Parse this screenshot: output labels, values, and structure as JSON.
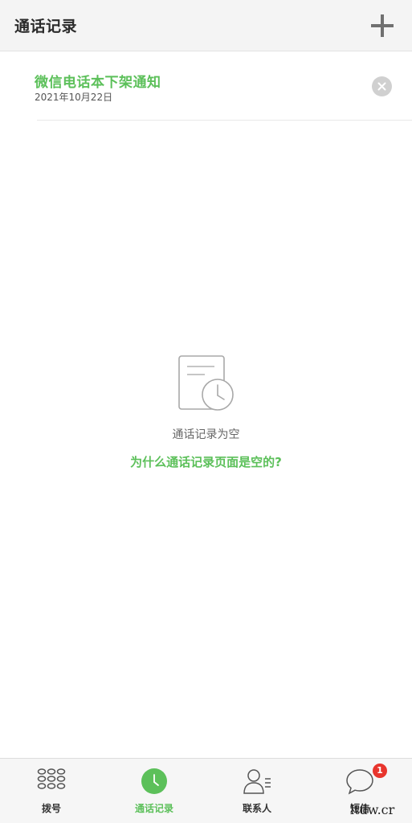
{
  "header": {
    "title": "通话记录"
  },
  "notice": {
    "title": "微信电话本下架通知",
    "date": "2021年10月22日"
  },
  "empty_state": {
    "message": "通话记录为空",
    "help_link": "为什么通话记录页面是空的?"
  },
  "bottom_nav": {
    "items": [
      {
        "label": "拨号",
        "icon": "dialpad-icon"
      },
      {
        "label": "通话记录",
        "icon": "clock-icon",
        "active": true
      },
      {
        "label": "联系人",
        "icon": "contacts-icon"
      },
      {
        "label": "短信",
        "icon": "message-icon",
        "badge": "1"
      }
    ]
  },
  "watermark": "ltdw.cr",
  "colors": {
    "accent": "#5cc05a",
    "badge": "#e8352d",
    "header_bg": "#f4f4f4"
  }
}
